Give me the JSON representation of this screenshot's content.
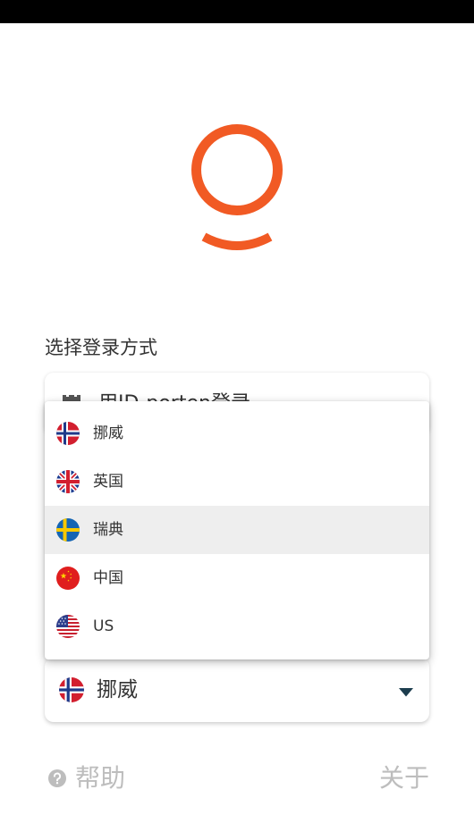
{
  "colors": {
    "accent": "#f15a24",
    "caret": "#1c3d4e",
    "muted": "#bdbdbd",
    "highlight": "#eeeeee",
    "text": "#333333"
  },
  "logo": {
    "icon": "app-logo"
  },
  "login": {
    "heading": "选择登录方式",
    "options": [
      {
        "label": "用ID-porten登录",
        "icon": "castle-icon"
      }
    ]
  },
  "country_menu": {
    "items": [
      {
        "label": "挪威",
        "icon": "norway-flag-icon"
      },
      {
        "label": "英国",
        "icon": "uk-flag-icon"
      },
      {
        "label": "瑞典",
        "icon": "sweden-flag-icon"
      },
      {
        "label": "中国",
        "icon": "china-flag-icon"
      },
      {
        "label": "US",
        "icon": "us-flag-icon"
      }
    ],
    "highlighted_index": 2
  },
  "country_select": {
    "value": "挪威",
    "icon": "norway-flag-icon",
    "caret_icon": "caret-down-icon"
  },
  "footer": {
    "help_label": "帮助",
    "help_icon": "help-circle-icon",
    "about_label": "关于"
  }
}
